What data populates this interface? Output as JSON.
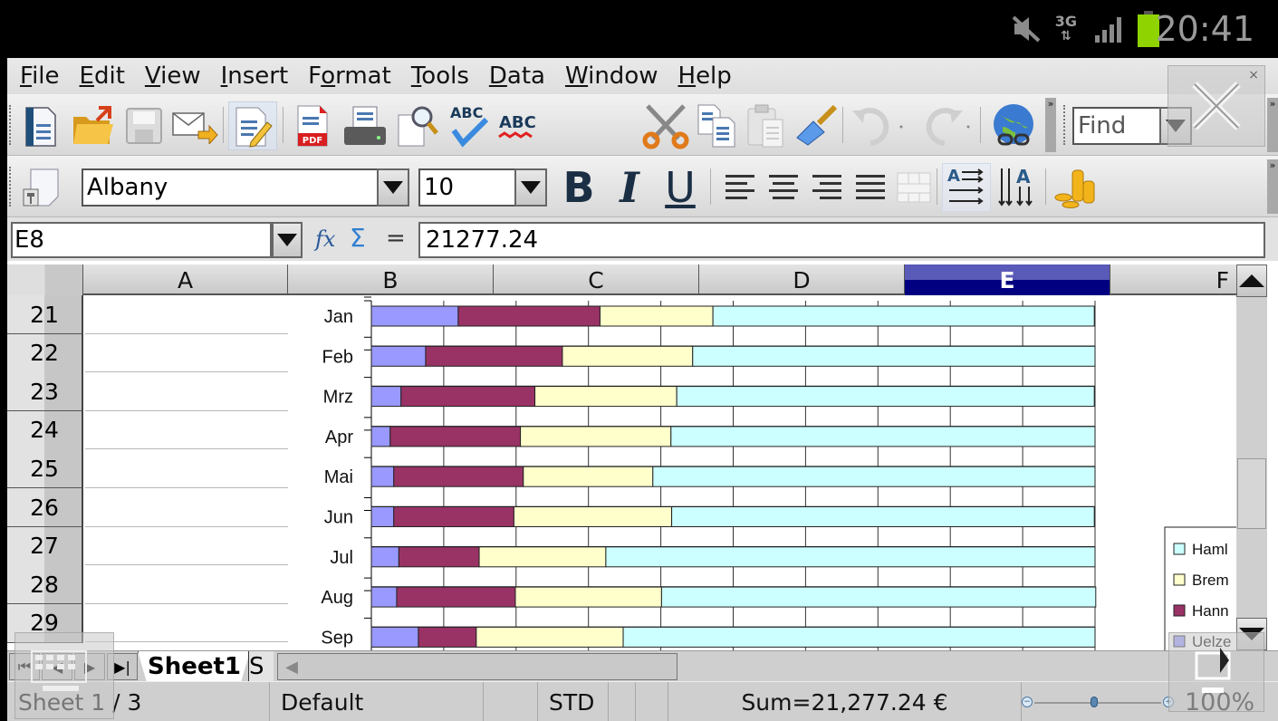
{
  "status_bar": {
    "time": "20:41",
    "network": "3G",
    "icons": [
      "mute-icon",
      "network-3g-icon",
      "signal-icon",
      "battery-icon"
    ],
    "battery_color": "#8fd400"
  },
  "menu": {
    "items": [
      {
        "label": "File",
        "mnemonic": "F",
        "rest": "ile"
      },
      {
        "label": "Edit",
        "mnemonic": "E",
        "rest": "dit"
      },
      {
        "label": "View",
        "mnemonic": "V",
        "rest": "iew"
      },
      {
        "label": "Insert",
        "mnemonic": "I",
        "rest": "nsert"
      },
      {
        "label": "Format",
        "pre": "F",
        "mnemonic": "o",
        "rest": "rmat"
      },
      {
        "label": "Tools",
        "mnemonic": "T",
        "rest": "ools"
      },
      {
        "label": "Data",
        "mnemonic": "D",
        "rest": "ata"
      },
      {
        "label": "Window",
        "mnemonic": "W",
        "rest": "indow"
      },
      {
        "label": "Help",
        "mnemonic": "H",
        "rest": "elp"
      }
    ]
  },
  "toolbar1": {
    "buttons": [
      "new",
      "open",
      "save",
      "email",
      "edit-file",
      "export-pdf",
      "print",
      "page-preview",
      "spellcheck",
      "autospellcheck",
      "cut",
      "copy",
      "paste",
      "clone-formatting",
      "undo",
      "redo",
      "hyperlink"
    ],
    "find_placeholder": "Find"
  },
  "toolbar2": {
    "font_name": "Albany",
    "font_size": "10",
    "buttons": [
      "bold",
      "italic",
      "underline",
      "align-left",
      "align-center",
      "align-right",
      "justify",
      "merge-cells",
      "text-left-to-right",
      "text-top-to-bottom",
      "currency"
    ],
    "bold_label": "B",
    "italic_label": "I",
    "underline_label": "U"
  },
  "formula_bar": {
    "cell_ref": "E8",
    "fx_label": "fx",
    "sum_label": "Σ",
    "equals_label": "=",
    "value": "21277.24"
  },
  "grid": {
    "columns": [
      "A",
      "B",
      "C",
      "D",
      "E",
      "F"
    ],
    "selected_column": "E",
    "rows": [
      "21",
      "22",
      "23",
      "24",
      "25",
      "26",
      "27",
      "28",
      "29"
    ]
  },
  "chart_data": {
    "type": "bar",
    "orientation": "horizontal",
    "stacking": "percent",
    "categories": [
      "Jan",
      "Feb",
      "Mrz",
      "Apr",
      "Mai",
      "Jun",
      "Jul",
      "Aug",
      "Sep"
    ],
    "series": [
      {
        "name": "Uelzen",
        "legend_visible": "Uelze",
        "color": "#9999ff",
        "values": [
          12.0,
          7.5,
          4.1,
          2.6,
          3.1,
          3.1,
          3.8,
          3.5,
          6.5
        ]
      },
      {
        "name": "Hannover",
        "legend_visible": "Hann",
        "color": "#993366",
        "values": [
          19.6,
          18.9,
          18.5,
          18.0,
          17.9,
          16.6,
          11.1,
          16.4,
          8.0
        ]
      },
      {
        "name": "Bremen",
        "legend_visible": "Brem",
        "color": "#ffffcc",
        "values": [
          15.6,
          18.0,
          19.6,
          20.8,
          17.9,
          21.8,
          17.5,
          20.2,
          20.3
        ]
      },
      {
        "name": "Hamburg",
        "legend_visible": "Haml",
        "color": "#ccffff",
        "values": [
          52.7,
          55.6,
          57.7,
          58.6,
          61.1,
          58.4,
          67.6,
          60.0,
          65.2
        ]
      }
    ],
    "xlim": [
      0,
      100
    ],
    "grid": true,
    "legend_position": "right",
    "legend_order": [
      "Hamburg",
      "Bremen",
      "Hannover",
      "Uelzen"
    ],
    "title": "",
    "xlabel": "",
    "ylabel": ""
  },
  "sheet_tabs": {
    "active": "Sheet1",
    "next_partial": "S"
  },
  "status_line": {
    "sheet": "Sheet 1 / 3",
    "page_style": "Default",
    "mode": "STD",
    "sum": "Sum=21,277.24 €",
    "zoom": "100%",
    "zoom_level": 100
  },
  "overlays": {
    "close_small": "×"
  }
}
